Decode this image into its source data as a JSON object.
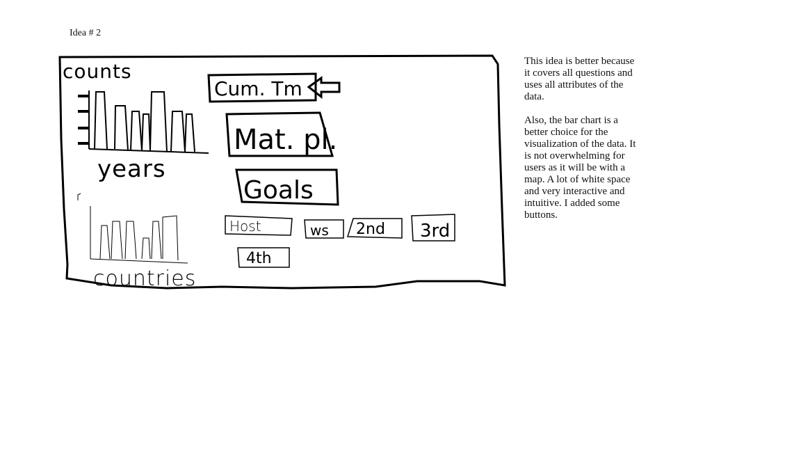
{
  "title": "Idea # 2",
  "sketch": {
    "top_chart": {
      "y_label": "counts",
      "x_label": "years"
    },
    "bottom_chart": {
      "x_label": "countries"
    },
    "tabs": {
      "cum_tm": "Cum. Tm",
      "mat_pl": "Mat. pl.",
      "goals": "Goals"
    },
    "buttons": {
      "host": "Host",
      "ws": "ws",
      "second": "2nd",
      "third": "3rd",
      "fourth": "4th"
    }
  },
  "notes": {
    "paragraph_1": "This idea is better because it covers all questions and uses all attributes of the data.",
    "paragraph_2": "Also, the bar chart is a better choice for the visualization of the data. It is not overwhelming for users as it will be with a map. A lot of white space and very interactive and intuitive. I added some buttons."
  },
  "colors": {
    "ink": "#000000",
    "background": "#ffffff"
  }
}
